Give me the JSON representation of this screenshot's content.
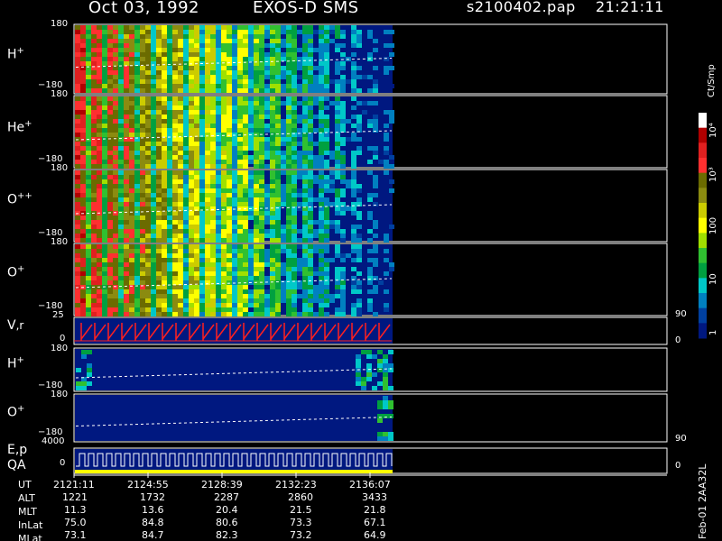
{
  "header": {
    "date": "Oct 03, 1992",
    "instrument": "EXOS-D SMS",
    "file": "s2100402.pap",
    "time": "21:21:11"
  },
  "panels": [
    {
      "label": "H",
      "sup": "+",
      "ymax": "180",
      "ymin": "−180"
    },
    {
      "label": "He",
      "sup": "+",
      "ymax": "180",
      "ymin": "−180"
    },
    {
      "label": "O",
      "sup": "++",
      "ymax": "180",
      "ymin": "−180"
    },
    {
      "label": "O",
      "sup": "+",
      "ymax": "180",
      "ymin": "−180"
    },
    {
      "label": "V",
      "sup": ",r",
      "ymax": "25",
      "ymin": "0",
      "rmax": "90",
      "rmin": "0"
    },
    {
      "label": "H",
      "sup": "+",
      "ymax": "180",
      "ymin": "−180"
    },
    {
      "label": "O",
      "sup": "+",
      "ymax": "180",
      "ymin": "−180"
    },
    {
      "label": "E,p",
      "sup": "",
      "label2": "QA",
      "ymax": "4000",
      "ymin": "0",
      "rmax": "90",
      "rmin": "0"
    }
  ],
  "colorbar": {
    "title": "Ct/Smp",
    "ticks": [
      "10⁴",
      "10³",
      "100",
      "10",
      "1"
    ],
    "colors": [
      "#ffffff",
      "#b00000",
      "#e02020",
      "#ff3030",
      "#6b6b00",
      "#8b8b10",
      "#cccc00",
      "#ffff00",
      "#a0e000",
      "#30c030",
      "#00a040",
      "#00c8c8",
      "#0080c0",
      "#0040a0",
      "#001880"
    ]
  },
  "sidebar_text": "Feb-01 2AA32L",
  "footer": {
    "row_labels": [
      "UT",
      "ALT",
      "MLT",
      "InLat",
      "MLat"
    ],
    "columns": [
      {
        "UT": "2121:11",
        "ALT": "1221",
        "MLT": "11.3",
        "InLat": "75.0",
        "MLat": "73.1"
      },
      {
        "UT": "2124:55",
        "ALT": "1732",
        "MLT": "13.6",
        "InLat": "84.8",
        "MLat": "84.7"
      },
      {
        "UT": "2128:39",
        "ALT": "2287",
        "MLT": "20.4",
        "InLat": "80.6",
        "MLat": "82.3"
      },
      {
        "UT": "2132:23",
        "ALT": "2860",
        "MLT": "21.5",
        "InLat": "73.3",
        "MLat": "73.2"
      },
      {
        "UT": "2136:07",
        "ALT": "3433",
        "MLT": "21.8",
        "InLat": "67.1",
        "MLat": "64.9"
      }
    ]
  },
  "chart_data": {
    "type": "heatmap",
    "x_ticks": [
      "2121:11",
      "2124:55",
      "2128:39",
      "2132:23",
      "2136:07"
    ],
    "colorscale": "log",
    "color_range": [
      1,
      10000
    ],
    "color_unit": "Ct/Smp"
  }
}
